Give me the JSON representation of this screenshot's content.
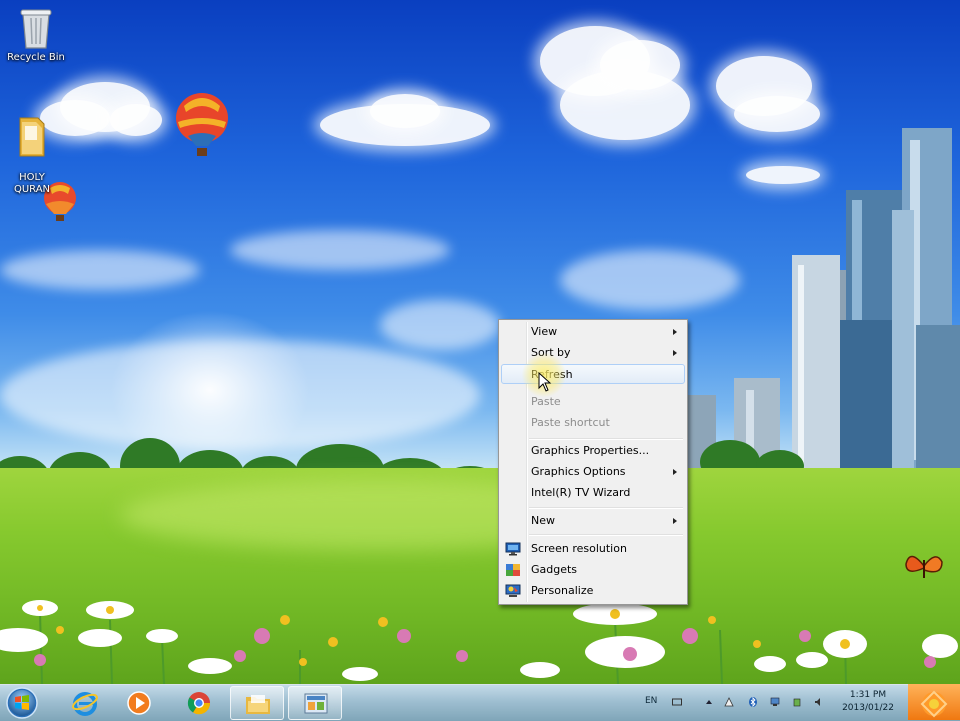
{
  "desktop": {
    "icons": [
      {
        "label": "Recycle Bin",
        "icon": "recycle-bin-icon"
      },
      {
        "label": "HOLY\nQURAN",
        "icon": "folder-icon"
      }
    ]
  },
  "context_menu": {
    "items": [
      {
        "label": "View",
        "submenu": true,
        "disabled": false
      },
      {
        "label": "Sort by",
        "submenu": true,
        "disabled": false
      },
      {
        "label": "Refresh",
        "submenu": false,
        "disabled": false,
        "hovered": true
      },
      {
        "label": "Paste",
        "submenu": false,
        "disabled": true
      },
      {
        "label": "Paste shortcut",
        "submenu": false,
        "disabled": true
      },
      {
        "label": "Graphics Properties...",
        "submenu": false,
        "disabled": false
      },
      {
        "label": "Graphics Options",
        "submenu": true,
        "disabled": false
      },
      {
        "label": "Intel(R) TV Wizard",
        "submenu": false,
        "disabled": false
      },
      {
        "label": "New",
        "submenu": true,
        "disabled": false
      },
      {
        "label": "Screen resolution",
        "submenu": false,
        "disabled": false,
        "icon": "monitor-icon"
      },
      {
        "label": "Gadgets",
        "submenu": false,
        "disabled": false,
        "icon": "gadgets-icon"
      },
      {
        "label": "Personalize",
        "submenu": false,
        "disabled": false,
        "icon": "personalize-icon"
      }
    ]
  },
  "taskbar": {
    "pinned": [
      {
        "icon": "internet-explorer-icon"
      },
      {
        "icon": "media-player-icon"
      },
      {
        "icon": "chrome-icon"
      },
      {
        "icon": "folder-explorer-icon"
      },
      {
        "icon": "control-panel-icon"
      }
    ],
    "tray": {
      "language": "EN",
      "time": "1:31 PM",
      "date": "2013/01/22"
    }
  },
  "colors": {
    "sky_top": "#0a3fc0",
    "grass": "#86c92e",
    "menu_bg": "#f0f0f0",
    "menu_hover_border": "#aecff7",
    "disabled_text": "#8d8d8d"
  }
}
